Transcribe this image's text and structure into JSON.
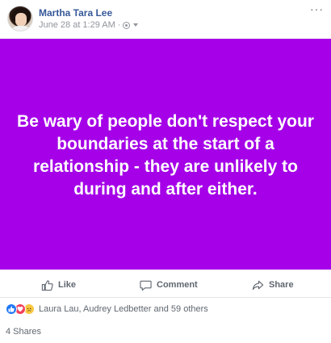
{
  "post": {
    "author": "Martha Tara Lee",
    "date": "June 28 at 1:29 AM",
    "separator": "·",
    "more_menu": "···",
    "card_text": "Be wary of people don't respect your boundaries at the start of a relationship - they are unlikely to during and after either.",
    "card_color": "#a500e8"
  },
  "actions": {
    "like": "Like",
    "comment": "Comment",
    "share": "Share"
  },
  "reactions": {
    "icons": [
      "like-icon",
      "love-icon",
      "sad-icon"
    ],
    "summary": "Laura Lau, Audrey Ledbetter and 59 others"
  },
  "shares": "4 Shares"
}
